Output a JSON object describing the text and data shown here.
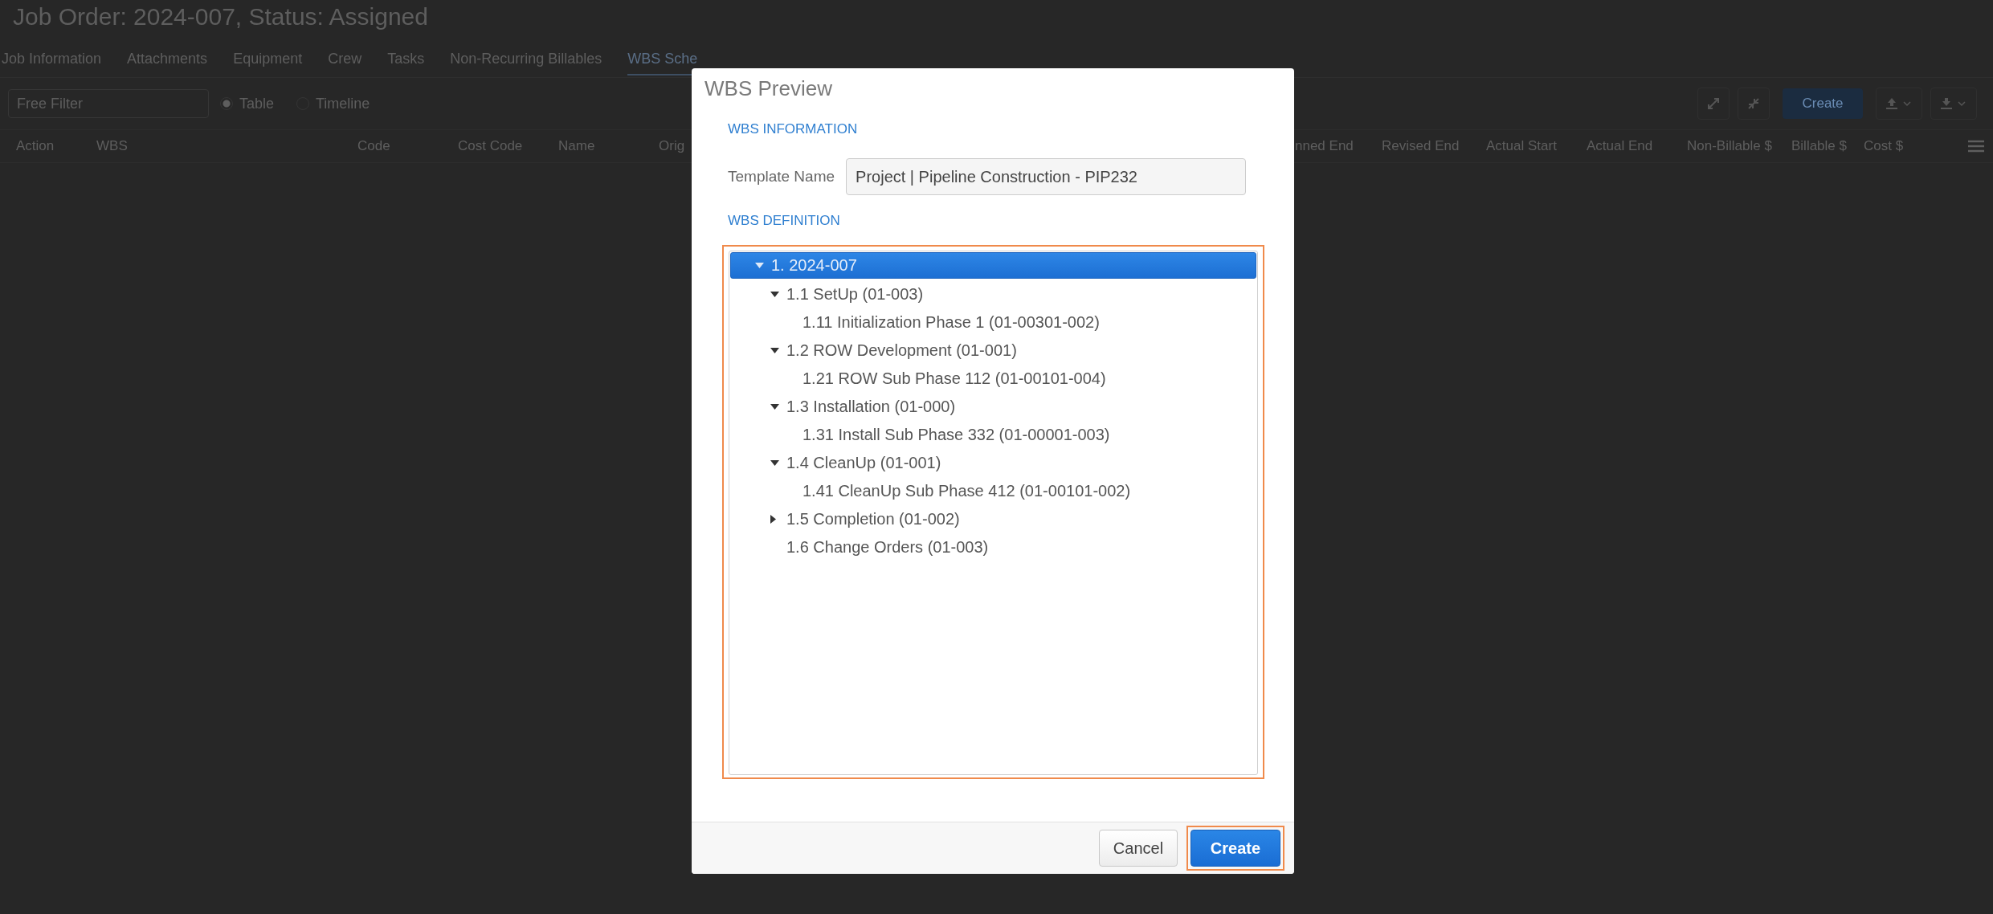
{
  "page": {
    "title": "Job Order: 2024-007, Status: Assigned",
    "tabs": [
      {
        "label": "Job Information",
        "selected": false
      },
      {
        "label": "Attachments",
        "selected": false
      },
      {
        "label": "Equipment",
        "selected": false
      },
      {
        "label": "Crew",
        "selected": false
      },
      {
        "label": "Tasks",
        "selected": false
      },
      {
        "label": "Non-Recurring Billables",
        "selected": false
      },
      {
        "label": "WBS Sche",
        "selected": true
      }
    ],
    "filter": {
      "placeholder": "Free Filter"
    },
    "view_options": [
      {
        "label": "Table",
        "selected": true
      },
      {
        "label": "Timeline",
        "selected": false
      }
    ],
    "toolbar": {
      "create_button": "Create"
    },
    "table": {
      "columns": [
        "Action",
        "WBS",
        "Code",
        "Cost Code",
        "Name",
        "Orig",
        "nned End",
        "Revised End",
        "Actual Start",
        "Actual End",
        "Non-Billable $",
        "Billable $",
        "Cost $"
      ]
    }
  },
  "dialog": {
    "title": "WBS Preview",
    "information": {
      "heading": "WBS INFORMATION",
      "template_name": {
        "label": "Template Name",
        "value": "Project | Pipeline Construction - PIP232"
      }
    },
    "definition": {
      "heading": "WBS DEFINITION",
      "highlighted": true,
      "tree": [
        {
          "label": "1. 2024-007",
          "expanded": true,
          "selected": true,
          "children": [
            {
              "label": "1.1 SetUp (01-003)",
              "expanded": true,
              "selected": false,
              "children": [
                {
                  "label": "1.11 Initialization Phase 1 (01-00301-002)",
                  "selected": false
                }
              ]
            },
            {
              "label": "1.2 ROW Development (01-001)",
              "expanded": true,
              "selected": false,
              "children": [
                {
                  "label": "1.21 ROW Sub Phase 112 (01-00101-004)",
                  "selected": false
                }
              ]
            },
            {
              "label": "1.3 Installation (01-000)",
              "expanded": true,
              "selected": false,
              "children": [
                {
                  "label": "1.31 Install Sub Phase 332 (01-00001-003)",
                  "selected": false
                }
              ]
            },
            {
              "label": "1.4 CleanUp (01-001)",
              "expanded": true,
              "selected": false,
              "children": [
                {
                  "label": "1.41 CleanUp Sub Phase 412 (01-00101-002)",
                  "selected": false
                }
              ]
            },
            {
              "label": "1.5 Completion (01-002)",
              "expanded": false,
              "selected": false
            },
            {
              "label": "1.6 Change Orders (01-003)",
              "selected": false
            }
          ]
        }
      ]
    },
    "buttons": [
      {
        "label": "Cancel",
        "kind": "secondary",
        "highlighted": false
      },
      {
        "label": "Create",
        "kind": "primary",
        "highlighted": true
      }
    ]
  }
}
